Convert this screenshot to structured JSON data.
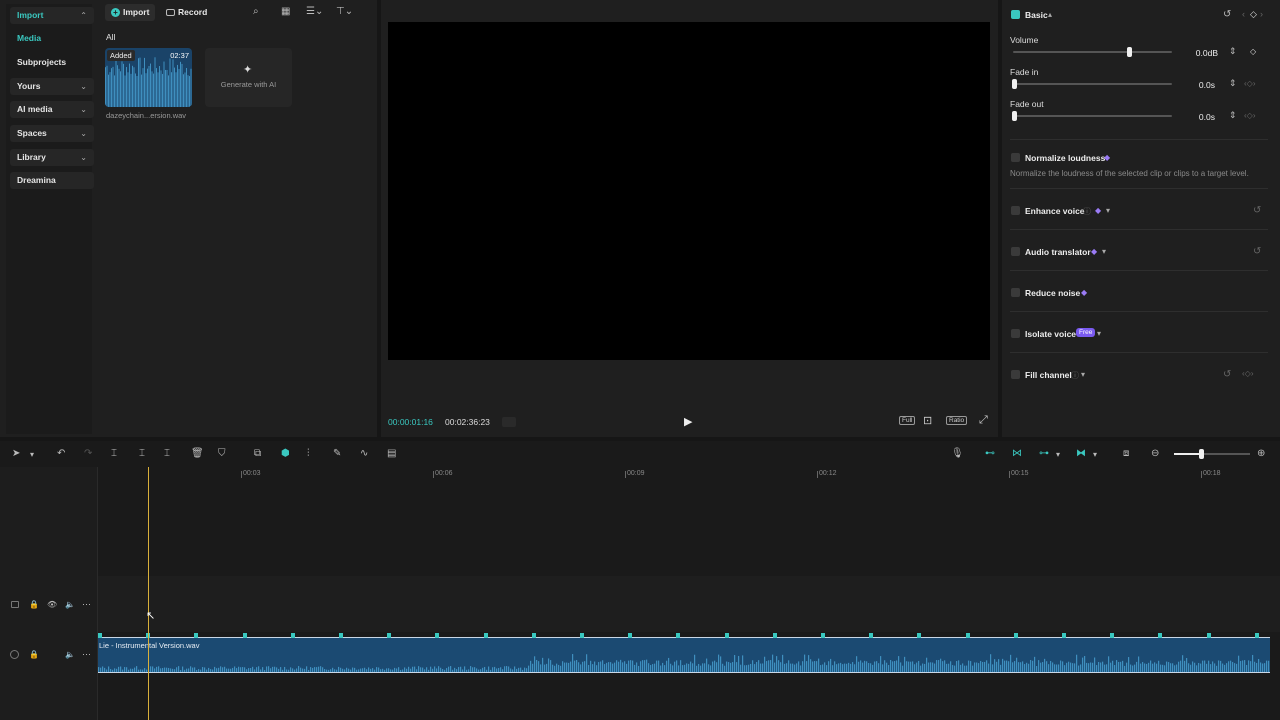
{
  "nav": {
    "import": "Import",
    "media": "Media",
    "subprojects": "Subprojects",
    "yours": "Yours",
    "ai_media": "AI media",
    "spaces": "Spaces",
    "library": "Library",
    "dreamina": "Dreamina"
  },
  "media_toolbar": {
    "import_label": "Import",
    "record_label": "Record",
    "filter_all": "All"
  },
  "media_item": {
    "badge": "Added",
    "duration": "02:37",
    "filename": "dazeychain...ersion.wav"
  },
  "generate_tile": {
    "label": "Generate with AI"
  },
  "player": {
    "current_time": "00:00:01:16",
    "total_time": "00:02:36:23",
    "full_label": "Full",
    "ratio_label": "Ratio"
  },
  "inspector": {
    "basic_label": "Basic",
    "volume_label": "Volume",
    "volume_value": "0.0dB",
    "volume_level": 0.73,
    "fade_in_label": "Fade in",
    "fade_in_value": "0.0s",
    "fade_out_label": "Fade out",
    "fade_out_value": "0.0s",
    "normalize_label": "Normalize loudness",
    "normalize_desc": "Normalize the loudness of the selected clip or clips to a target level.",
    "enhance_label": "Enhance voice",
    "translator_label": "Audio translator",
    "reduce_label": "Reduce noise",
    "isolate_label": "Isolate voice",
    "free_badge": "Free",
    "fill_label": "Fill channel"
  },
  "timeline": {
    "ruler": [
      "00:03",
      "00:06",
      "00:09",
      "00:12",
      "00:15",
      "00:18"
    ],
    "clip_name": "Lie - Instrumental Version.wav",
    "playhead_time_fraction": 0.01
  },
  "colors": {
    "accent": "#3ac8c0",
    "clip": "#1b4a72",
    "wave": "#3f8fbf",
    "playhead": "#d9b03a"
  }
}
